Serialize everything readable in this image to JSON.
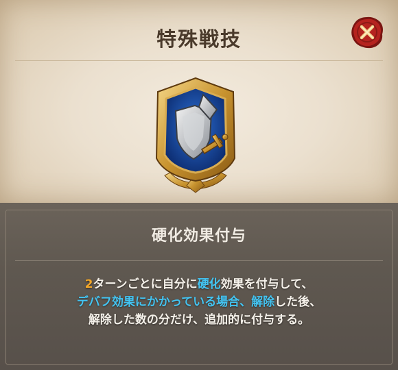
{
  "header": {
    "title": "特殊戦技"
  },
  "close_button": {
    "icon": "close-x-icon",
    "color": "#b5231f"
  },
  "skill": {
    "icon": "shield-sword-crest-icon",
    "name": "硬化効果付与",
    "description": {
      "line1": {
        "number": "2",
        "t1": "ターンごとに自分に",
        "kw1": "硬化",
        "t2": "効果を付与して、"
      },
      "line2": {
        "kw1": "デバフ効果にかかっている場合、",
        "kw2": "解除",
        "t1": "した後、"
      },
      "line3": {
        "t1": "解除した数の分だけ、追加的に付与する。"
      }
    }
  },
  "colors": {
    "highlight_number": "#f2a628",
    "highlight_keyword": "#43c4f2",
    "close_red": "#b5231f"
  }
}
